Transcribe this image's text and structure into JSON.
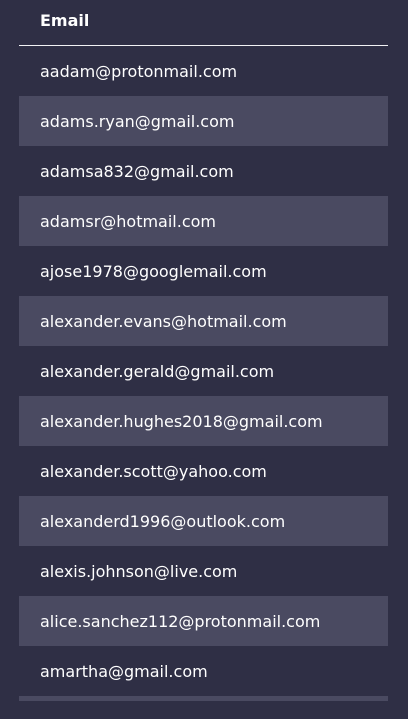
{
  "table": {
    "header": "Email",
    "rows": [
      "aadam@protonmail.com",
      "adams.ryan@gmail.com",
      "adamsa832@gmail.com",
      "adamsr@hotmail.com",
      "ajose1978@googlemail.com",
      "alexander.evans@hotmail.com",
      "alexander.gerald@gmail.com",
      "alexander.hughes2018@gmail.com",
      "alexander.scott@yahoo.com",
      "alexanderd1996@outlook.com",
      "alexis.johnson@live.com",
      "alice.sanchez112@protonmail.com",
      "amartha@gmail.com"
    ]
  },
  "colors": {
    "background": "#2f2f45",
    "row_shaded": "#4a4a61",
    "text": "#ffffff",
    "header_rule": "#f2f2f5"
  }
}
